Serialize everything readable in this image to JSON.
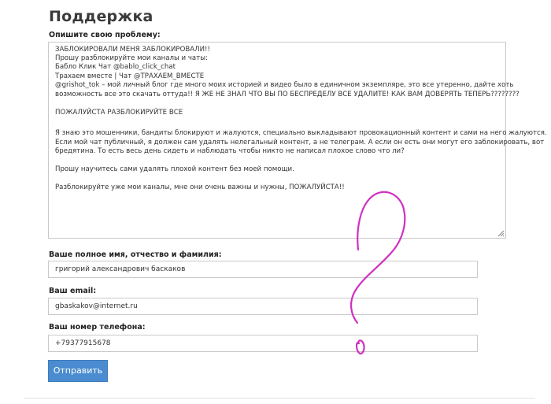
{
  "page": {
    "title": "Поддержка"
  },
  "form": {
    "problem_label": "Опишите свою проблему:",
    "problem_lines": [
      "ЗАБЛОКИРОВАЛИ МЕНЯ ЗАБЛОКИРОВАЛИ!!",
      "Прошу разблокируйте мои каналы и чаты:",
      " Бабло Клик Чат @bablo_click_chat",
      "Трахаем вместе | Чат @ТРАХАЕМ_ВМЕСТЕ",
      "@grishot_tok – мой личный блог где много моих историей и видео было в единичном экземпляре, это все утеренно, дайте хоть",
      "возможность все это скачать оттуда!! Я ЖЕ НЕ ЗНАЛ ЧТО ВЫ ПО БЕСПРЕДЕЛУ ВСЕ УДАЛИТЕ! КАК ВАМ ДОВЕРЯТЬ ТЕПЕРЬ????????",
      "",
      "ПОЖАЛУЙСТА РАЗБЛОКИРУЙТЕ ВСЕ",
      "",
      "Я знаю это мошенники, бандиты блокируют и жалуются, специально выкладывают провокационный контент и сами на него жалуются.",
      "Если мой чат публичный, я должен сам удалять нелегальный контент, а не телеграм. А если он есть они могут его заблокировать, вот",
      "бредятина. То есть весь день сидеть и наблюдать чтобы никто не написал плохое слово что ли?",
      "",
      "Прошу научитесь сами удалять плохой контент без моей помощи.",
      "",
      "Разблокируйте уже мои каналы, мне они очень важны и нужны, ПОЖАЛУЙСТА!!"
    ],
    "name_label": "Ваше полное имя, отчество и фамилия:",
    "name_value": "григорий александрович баскаков",
    "email_label": "Ваш email:",
    "email_value": "gbaskakov@internet.ru",
    "phone_label": "Ваш номер телефона:",
    "phone_value": "+79377915678",
    "submit_label": "Отправить"
  },
  "colors": {
    "button": "#4a8ccf",
    "scribble": "#d030c0"
  }
}
